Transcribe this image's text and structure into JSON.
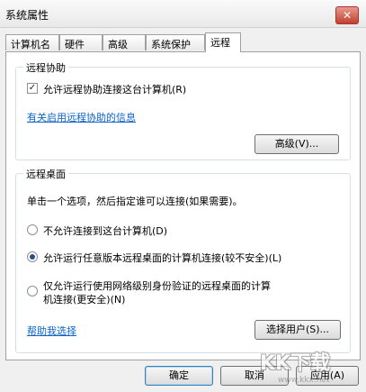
{
  "window": {
    "title": "系统属性"
  },
  "tabs": [
    "计算机名",
    "硬件",
    "高级",
    "系统保护",
    "远程"
  ],
  "remote_assistance": {
    "group_title": "远程协助",
    "allow_checkbox_label": "允许远程协助连接这台计算机(R)",
    "allow_checked": true,
    "info_link": "有关启用远程协助的信息",
    "advanced_button": "高级(V)..."
  },
  "remote_desktop": {
    "group_title": "远程桌面",
    "instruction": "单击一个选项，然后指定谁可以连接(如果需要)。",
    "options": [
      "不允许连接到这台计算机(D)",
      "允许运行任意版本远程桌面的计算机连接(较不安全)(L)",
      "仅允许运行使用网络级别身份验证的远程桌面的计算机连接(更安全)(N)"
    ],
    "option3_line1": "仅允许运行使用网络级别身份验证的远程桌面的计算",
    "option3_line2": "机连接(更安全)(N)",
    "selected_index": 1,
    "help_link": "帮助我选择",
    "select_users_button": "选择用户(S)..."
  },
  "footer": {
    "ok": "确定",
    "cancel": "取消",
    "apply": "应用(A)"
  },
  "watermark": {
    "main": "KK下载",
    "sub": "www.kkx.net"
  },
  "colors": {
    "link": "#0a63c9",
    "radio_selected": "#2a4d8c",
    "close_button": "#c2402d"
  }
}
